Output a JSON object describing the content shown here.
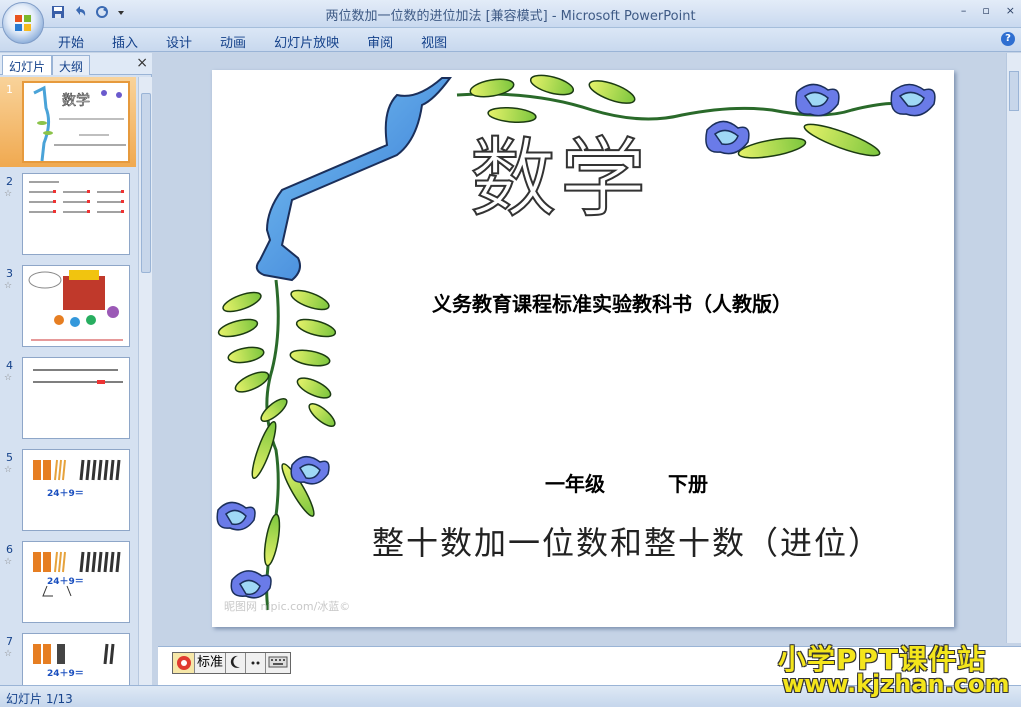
{
  "window": {
    "title": "两位数加一位数的进位加法 [兼容模式] - Microsoft PowerPoint",
    "controls": [
      "–",
      "▫",
      "×"
    ]
  },
  "ribbon": {
    "tabs": [
      "开始",
      "插入",
      "设计",
      "动画",
      "幻灯片放映",
      "审阅",
      "视图"
    ]
  },
  "left_pane": {
    "tabs": [
      "幻灯片",
      "大纲"
    ],
    "close": "×",
    "thumbnails": [
      {
        "num": "1",
        "selected": true
      },
      {
        "num": "2",
        "star": "☆"
      },
      {
        "num": "3",
        "star": "☆"
      },
      {
        "num": "4",
        "star": "☆"
      },
      {
        "num": "5",
        "star": "☆"
      },
      {
        "num": "6",
        "star": "☆"
      },
      {
        "num": "7",
        "star": "☆"
      }
    ]
  },
  "slide": {
    "title": "数学",
    "subtitle": "义务教育课程标准实验教科书（人教版）",
    "grade": "一年级",
    "volume": "下册",
    "topic": "整十数加一位数和整十数（进位）",
    "credit": "昵图网 nipic.com/冰蓝©"
  },
  "ime_bar": {
    "mode": "标准"
  },
  "status": {
    "slide_indicator": "幻灯片 1/13"
  },
  "watermark": {
    "line1": "小学PPT课件站",
    "line2": "www.kjzhan.com"
  },
  "colors": {
    "selected_thumb": "#f0a950",
    "title_bar_text": "#3e5a85",
    "watermark": "#f4e51b"
  }
}
